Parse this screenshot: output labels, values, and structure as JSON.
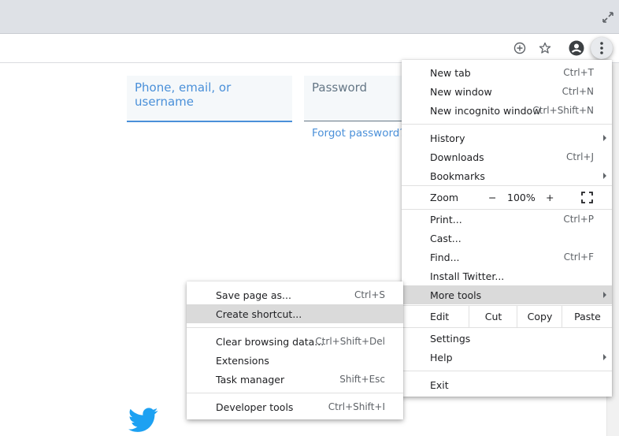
{
  "browser": {
    "toolbar_icons": [
      "add-circle-icon",
      "star-icon",
      "account-icon",
      "kebab-menu-icon"
    ]
  },
  "page": {
    "phone_placeholder": "Phone, email, or username",
    "password_placeholder": "Password",
    "forgot_password": "Forgot password?"
  },
  "main_menu": {
    "new_tab": {
      "label": "New tab",
      "shortcut": "Ctrl+T"
    },
    "new_window": {
      "label": "New window",
      "shortcut": "Ctrl+N"
    },
    "new_incognito": {
      "label": "New incognito window",
      "shortcut": "Ctrl+Shift+N"
    },
    "history": {
      "label": "History"
    },
    "downloads": {
      "label": "Downloads",
      "shortcut": "Ctrl+J"
    },
    "bookmarks": {
      "label": "Bookmarks"
    },
    "zoom": {
      "label": "Zoom",
      "minus": "−",
      "level": "100%",
      "plus": "+"
    },
    "print": {
      "label": "Print...",
      "shortcut": "Ctrl+P"
    },
    "cast": {
      "label": "Cast..."
    },
    "find": {
      "label": "Find...",
      "shortcut": "Ctrl+F"
    },
    "install": {
      "label": "Install Twitter..."
    },
    "more_tools": {
      "label": "More tools"
    },
    "edit": {
      "label": "Edit",
      "cut": "Cut",
      "copy": "Copy",
      "paste": "Paste"
    },
    "settings": {
      "label": "Settings"
    },
    "help": {
      "label": "Help"
    },
    "exit": {
      "label": "Exit"
    }
  },
  "sub_menu": {
    "save_page": {
      "label": "Save page as...",
      "shortcut": "Ctrl+S"
    },
    "create_shortcut": {
      "label": "Create shortcut..."
    },
    "clear_data": {
      "label": "Clear browsing data...",
      "shortcut": "Ctrl+Shift+Del"
    },
    "extensions": {
      "label": "Extensions"
    },
    "task_manager": {
      "label": "Task manager",
      "shortcut": "Shift+Esc"
    },
    "dev_tools": {
      "label": "Developer tools",
      "shortcut": "Ctrl+Shift+I"
    }
  },
  "colors": {
    "accent": "#4a90d9",
    "highlight": "#dadada",
    "twitter": "#1da1f2"
  }
}
